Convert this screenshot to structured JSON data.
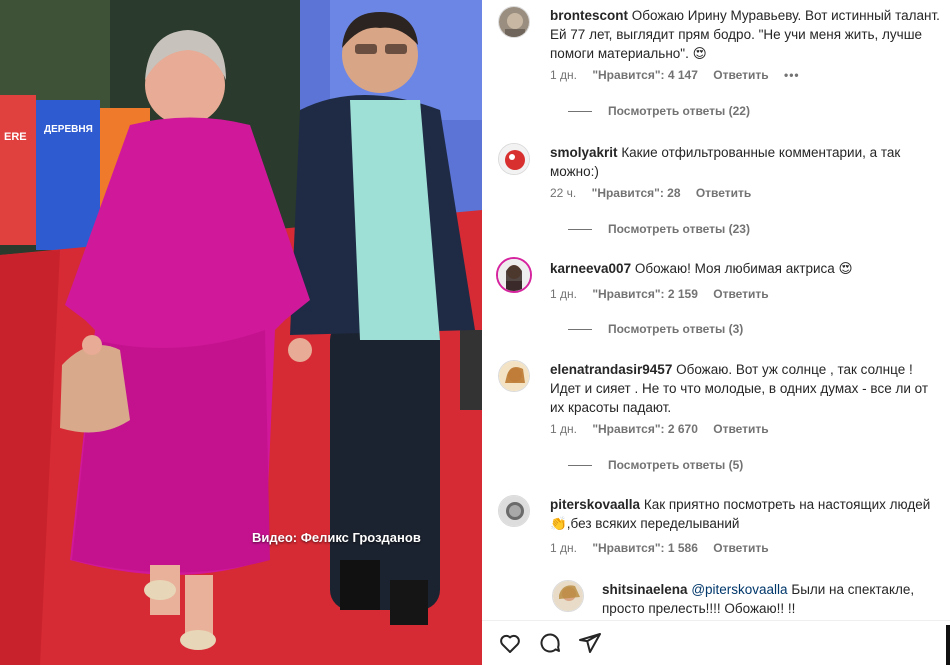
{
  "media": {
    "watermark": "Видео: Феликс Грозданов"
  },
  "comments": [
    {
      "username": "brontescont",
      "text": "Обожаю Ирину Муравьеву. Вот истинный талант. Ей 77 лет, выглядит прям бодро. \"Не учи меня жить, лучше помоги материально\". 😍",
      "time": "1 дн.",
      "likes": "\"Нравится\": 4 147",
      "reply": "Ответить",
      "more": "•••",
      "view_replies": "Посмотреть ответы (22)"
    },
    {
      "username": "smolyakrit",
      "text": "Какие отфильтрованные комментарии, а так можно:)",
      "time": "22 ч.",
      "likes": "\"Нравится\": 28",
      "reply": "Ответить",
      "view_replies": "Посмотреть ответы (23)"
    },
    {
      "username": "karneeva007",
      "text": "Обожаю! Моя любимая актриса 😍",
      "time": "1 дн.",
      "likes": "\"Нравится\": 2 159",
      "reply": "Ответить",
      "view_replies": "Посмотреть ответы (3)"
    },
    {
      "username": "elenatrandasir9457",
      "text": "Обожаю. Вот уж солнце , так солнце ! Идет и сияет . Не то что молодые, в одних думах - все ли от их красоты падают.",
      "time": "1 дн.",
      "likes": "\"Нравится\": 2 670",
      "reply": "Ответить",
      "view_replies": "Посмотреть ответы (5)"
    },
    {
      "username": "piterskovaalla",
      "text": "Как приятно посмотреть на настоящих людей 👏,без всяких переделываний",
      "time": "1 дн.",
      "likes": "\"Нравится\": 1 586",
      "reply": "Ответить"
    }
  ],
  "reply_comment": {
    "username": "shitsinaelena",
    "mention": "@piterskovaalla",
    "text": "Были на спектакле, просто прелесть!!!! Обожаю!! !!"
  },
  "actions": {
    "like_icon": "heart-icon",
    "comment_icon": "comment-icon",
    "share_icon": "share-icon"
  },
  "colors": {
    "link": "#00376b",
    "muted": "#737373",
    "text": "#262626"
  }
}
